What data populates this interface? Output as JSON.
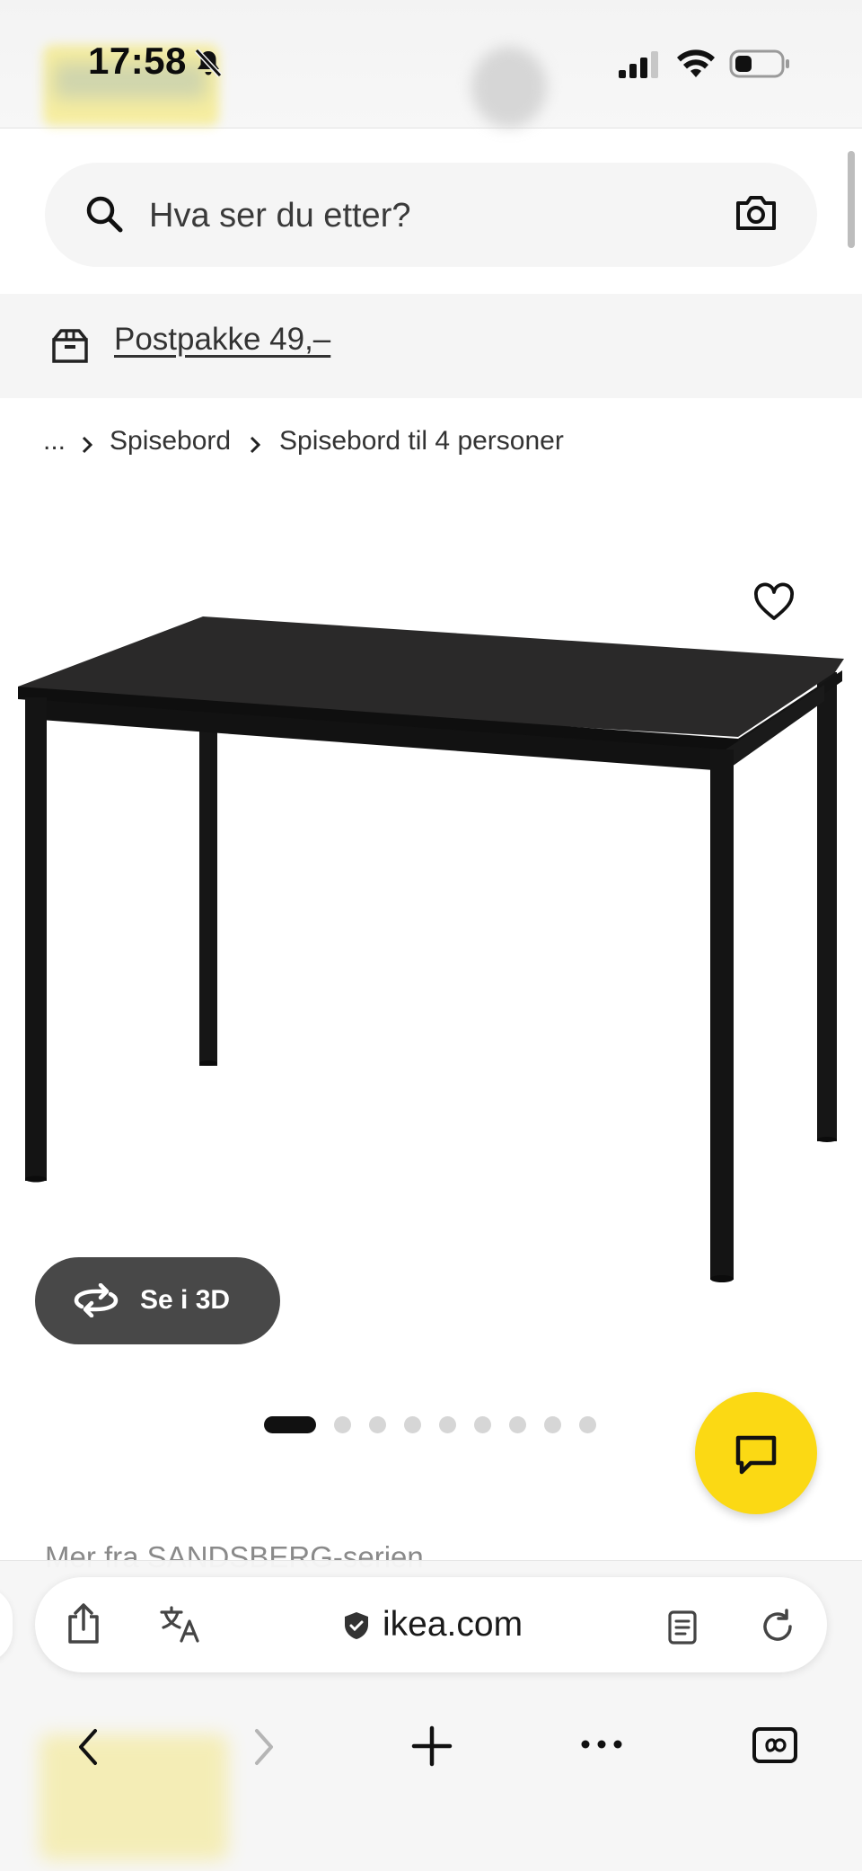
{
  "status_bar": {
    "time": "17:58"
  },
  "search": {
    "placeholder": "Hva ser du etter?"
  },
  "shipping_banner": {
    "label": "Postpakke 49,–"
  },
  "breadcrumb": {
    "ellipsis": "...",
    "items": [
      "Spisebord",
      "Spisebord til 4 personer"
    ]
  },
  "product": {
    "view_3d_label": "Se i 3D",
    "image_count": 9,
    "active_image": 1
  },
  "series_heading": "Mer fra SANDSBERG-serien",
  "browser": {
    "url": "ikea.com"
  },
  "colors": {
    "chat_button": "#fbd914",
    "view_3d_button": "#484848",
    "table": "#1b1b1b"
  },
  "icons": {
    "search": "search-icon",
    "camera": "camera-icon",
    "shipping": "box-icon",
    "favorite": "heart-icon",
    "rotate": "rotate-icon",
    "chat": "chat-icon",
    "share": "share-icon",
    "translate": "translate-icon",
    "lock": "shield-lock-icon",
    "reader": "reader-icon",
    "reload": "reload-icon",
    "back": "back-icon",
    "forward": "forward-icon",
    "new_tab": "plus-icon",
    "more": "more-icon",
    "tabs": "tabs-icon"
  }
}
